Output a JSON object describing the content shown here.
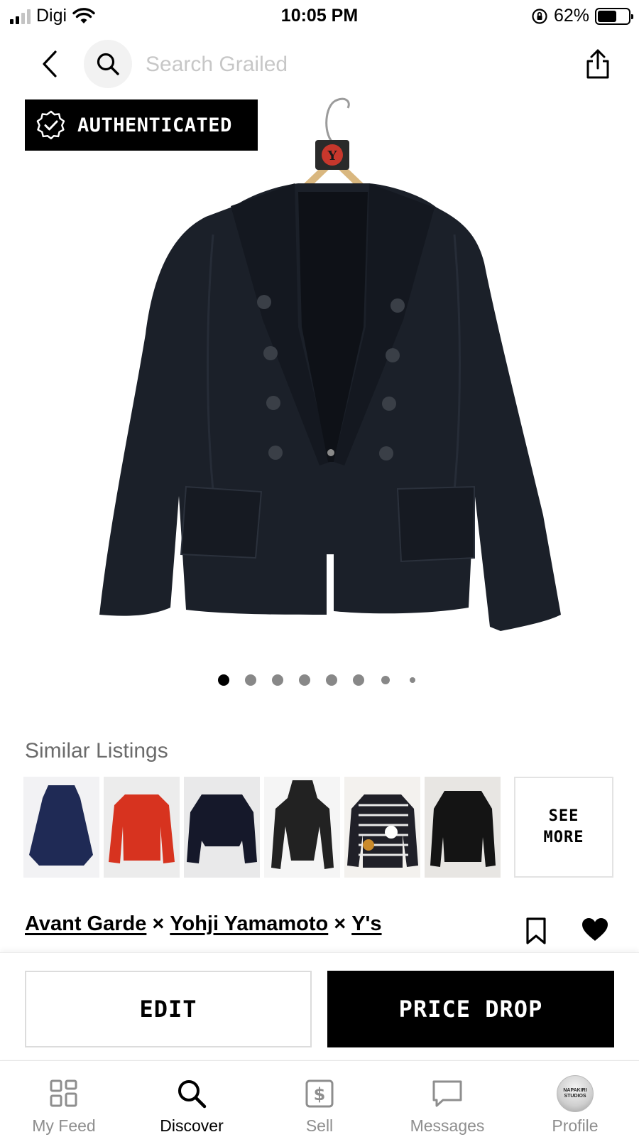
{
  "status_bar": {
    "carrier": "Digi",
    "time": "10:05 PM",
    "battery_percent": "62%",
    "battery_level": 0.62
  },
  "header": {
    "search_placeholder": "Search Grailed",
    "icons": [
      "chevron-left-icon",
      "search-icon",
      "share-icon"
    ]
  },
  "product": {
    "badge_label": "AUTHENTICATED",
    "hanger_logo_text": "Y",
    "image_count": 8,
    "active_image_index": 0
  },
  "similar_listings": {
    "title": "Similar Listings",
    "see_more_label": "SEE\nMORE",
    "items": [
      {
        "name": "navy-coat",
        "bg": "#f2f2f4",
        "garment": "#1f2a55"
      },
      {
        "name": "red-jacket",
        "bg": "#ececec",
        "garment": "#d7331f"
      },
      {
        "name": "navy-fur-jacket",
        "bg": "#e9e9ea",
        "garment": "#15182a"
      },
      {
        "name": "black-hoodie-corset",
        "bg": "#f5f5f5",
        "garment": "#222"
      },
      {
        "name": "plaid-hello-kitty-top",
        "bg": "#f3f1ee",
        "garment": "#202028"
      },
      {
        "name": "black-peacoat",
        "bg": "#e8e6e3",
        "garment": "#141414"
      }
    ]
  },
  "designers": {
    "names": [
      "Avant Garde",
      "Yohji Yamamoto",
      "Y's"
    ],
    "separator": "×"
  },
  "actions": {
    "edit_label": "EDIT",
    "price_drop_label": "PRICE DROP"
  },
  "tabs": [
    {
      "label": "My Feed",
      "icon": "feed-grid-icon",
      "active": false
    },
    {
      "label": "Discover",
      "icon": "search-icon",
      "active": true
    },
    {
      "label": "Sell",
      "icon": "dollar-tag-icon",
      "active": false
    },
    {
      "label": "Messages",
      "icon": "chat-bubble-icon",
      "active": false
    },
    {
      "label": "Profile",
      "icon": "avatar",
      "active": false
    }
  ],
  "profile_avatar_text": "NAPAKIRI STUDIOS",
  "colors": {
    "accent": "#000000",
    "inactive_tab": "#8e8e8e",
    "placeholder": "#c7c7c7"
  }
}
